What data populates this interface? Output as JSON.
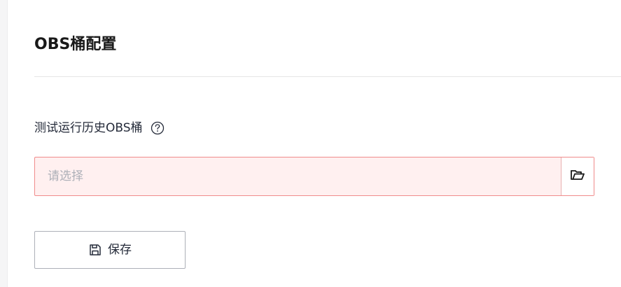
{
  "section": {
    "title": "OBS桶配置"
  },
  "field": {
    "label": "测试运行历史OBS桶",
    "placeholder": "请选择",
    "help_icon": "question-circle-icon",
    "browse_icon": "folder-open-icon"
  },
  "actions": {
    "save_label": "保存",
    "save_icon": "save-icon"
  },
  "colors": {
    "error_border": "#f08b8b",
    "error_background": "#fff0f0",
    "placeholder_text": "#adb0b8",
    "title_text": "#191919"
  }
}
